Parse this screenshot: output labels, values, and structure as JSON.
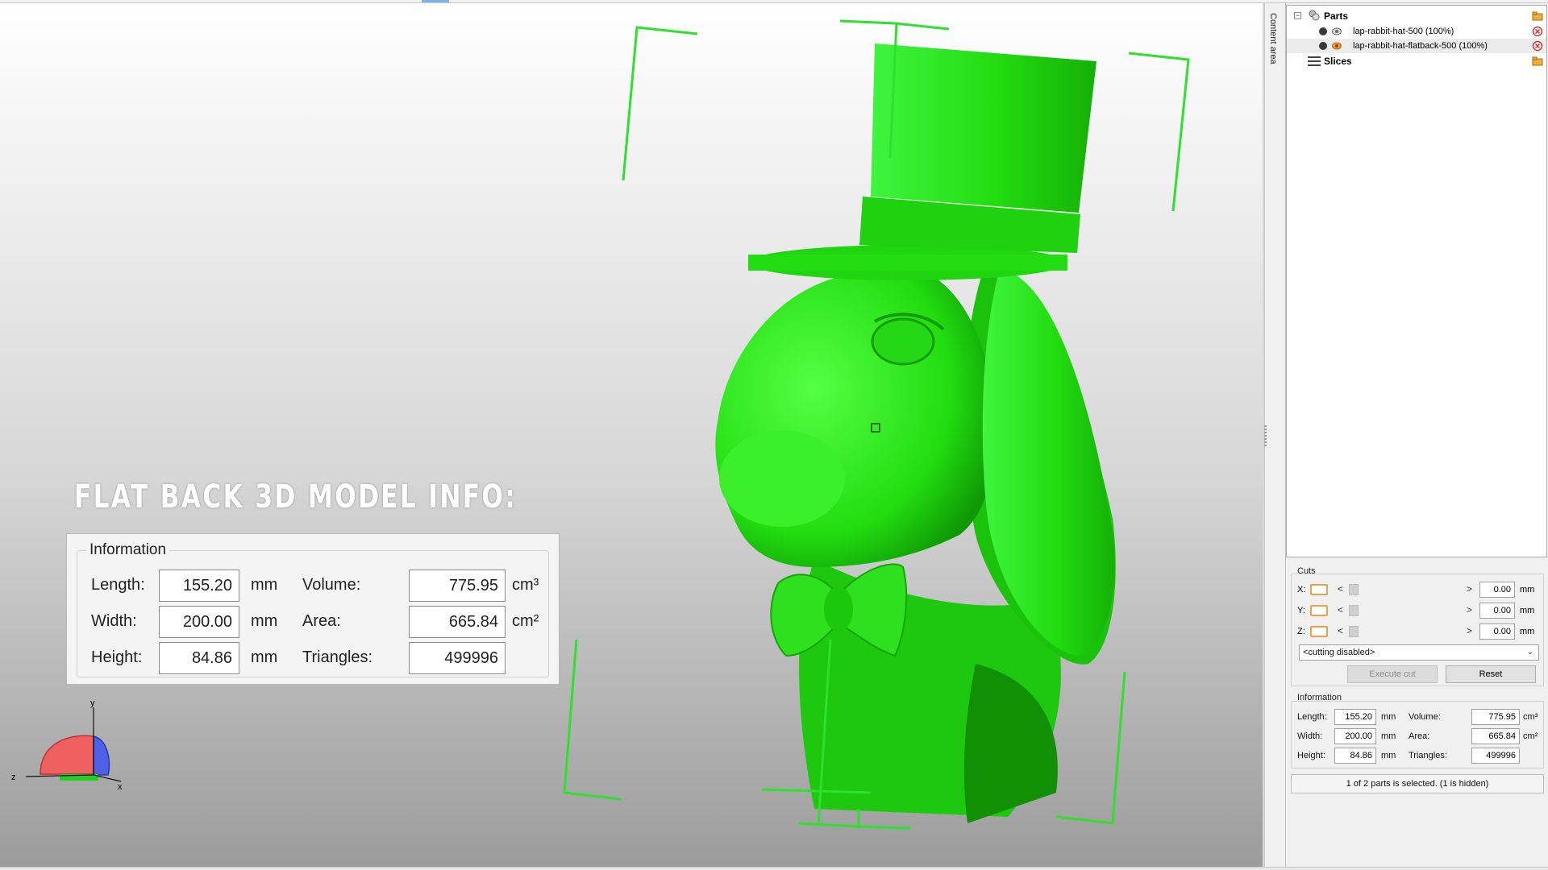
{
  "viewport": {
    "overlay_title": "FLAT BACK 3D MODEL INFO:",
    "model_color": "#22e000",
    "bracket_color": "#2fe02f",
    "cursor_marker": "selection-square-icon"
  },
  "big_info": {
    "legend": "Information",
    "length_label": "Length:",
    "length_value": "155.20",
    "width_label": "Width:",
    "width_value": "200.00",
    "height_label": "Height:",
    "height_value": "84.86",
    "mm": "mm",
    "volume_label": "Volume:",
    "volume_value": "775.95",
    "volume_unit": "cm³",
    "area_label": "Area:",
    "area_value": "665.84",
    "area_unit": "cm²",
    "triangles_label": "Triangles:",
    "triangles_value": "499996"
  },
  "gizmo": {
    "y": "y",
    "z": "z",
    "x": "x"
  },
  "side_tab": {
    "label": "Content area"
  },
  "tree": {
    "parts_label": "Parts",
    "items": [
      {
        "label": "lap-rabbit-hat-500 (100%)"
      },
      {
        "label": "lap-rabbit-hat-flatback-500 (100%)"
      }
    ],
    "slices_label": "Slices",
    "expander_symbol": "−"
  },
  "cuts": {
    "label": "Cuts",
    "rows": [
      {
        "axis": "X:",
        "value": "0.00",
        "unit": "mm"
      },
      {
        "axis": "Y:",
        "value": "0.00",
        "unit": "mm"
      },
      {
        "axis": "Z:",
        "value": "0.00",
        "unit": "mm"
      }
    ],
    "left_arrow": "<",
    "right_arrow": ">",
    "mode": "<cutting disabled>",
    "execute_label": "Execute cut",
    "reset_label": "Reset"
  },
  "info": {
    "label": "Information",
    "length_label": "Length:",
    "length_value": "155.20",
    "width_label": "Width:",
    "width_value": "200.00",
    "height_label": "Height:",
    "height_value": "84.86",
    "mm": "mm",
    "volume_label": "Volume:",
    "volume_value": "775.95",
    "volume_unit": "cm³",
    "area_label": "Area:",
    "area_value": "665.84",
    "area_unit": "cm²",
    "triangles_label": "Triangles:",
    "triangles_value": "499996"
  },
  "status": {
    "text": "1 of 2 parts is selected. (1 is hidden)"
  }
}
